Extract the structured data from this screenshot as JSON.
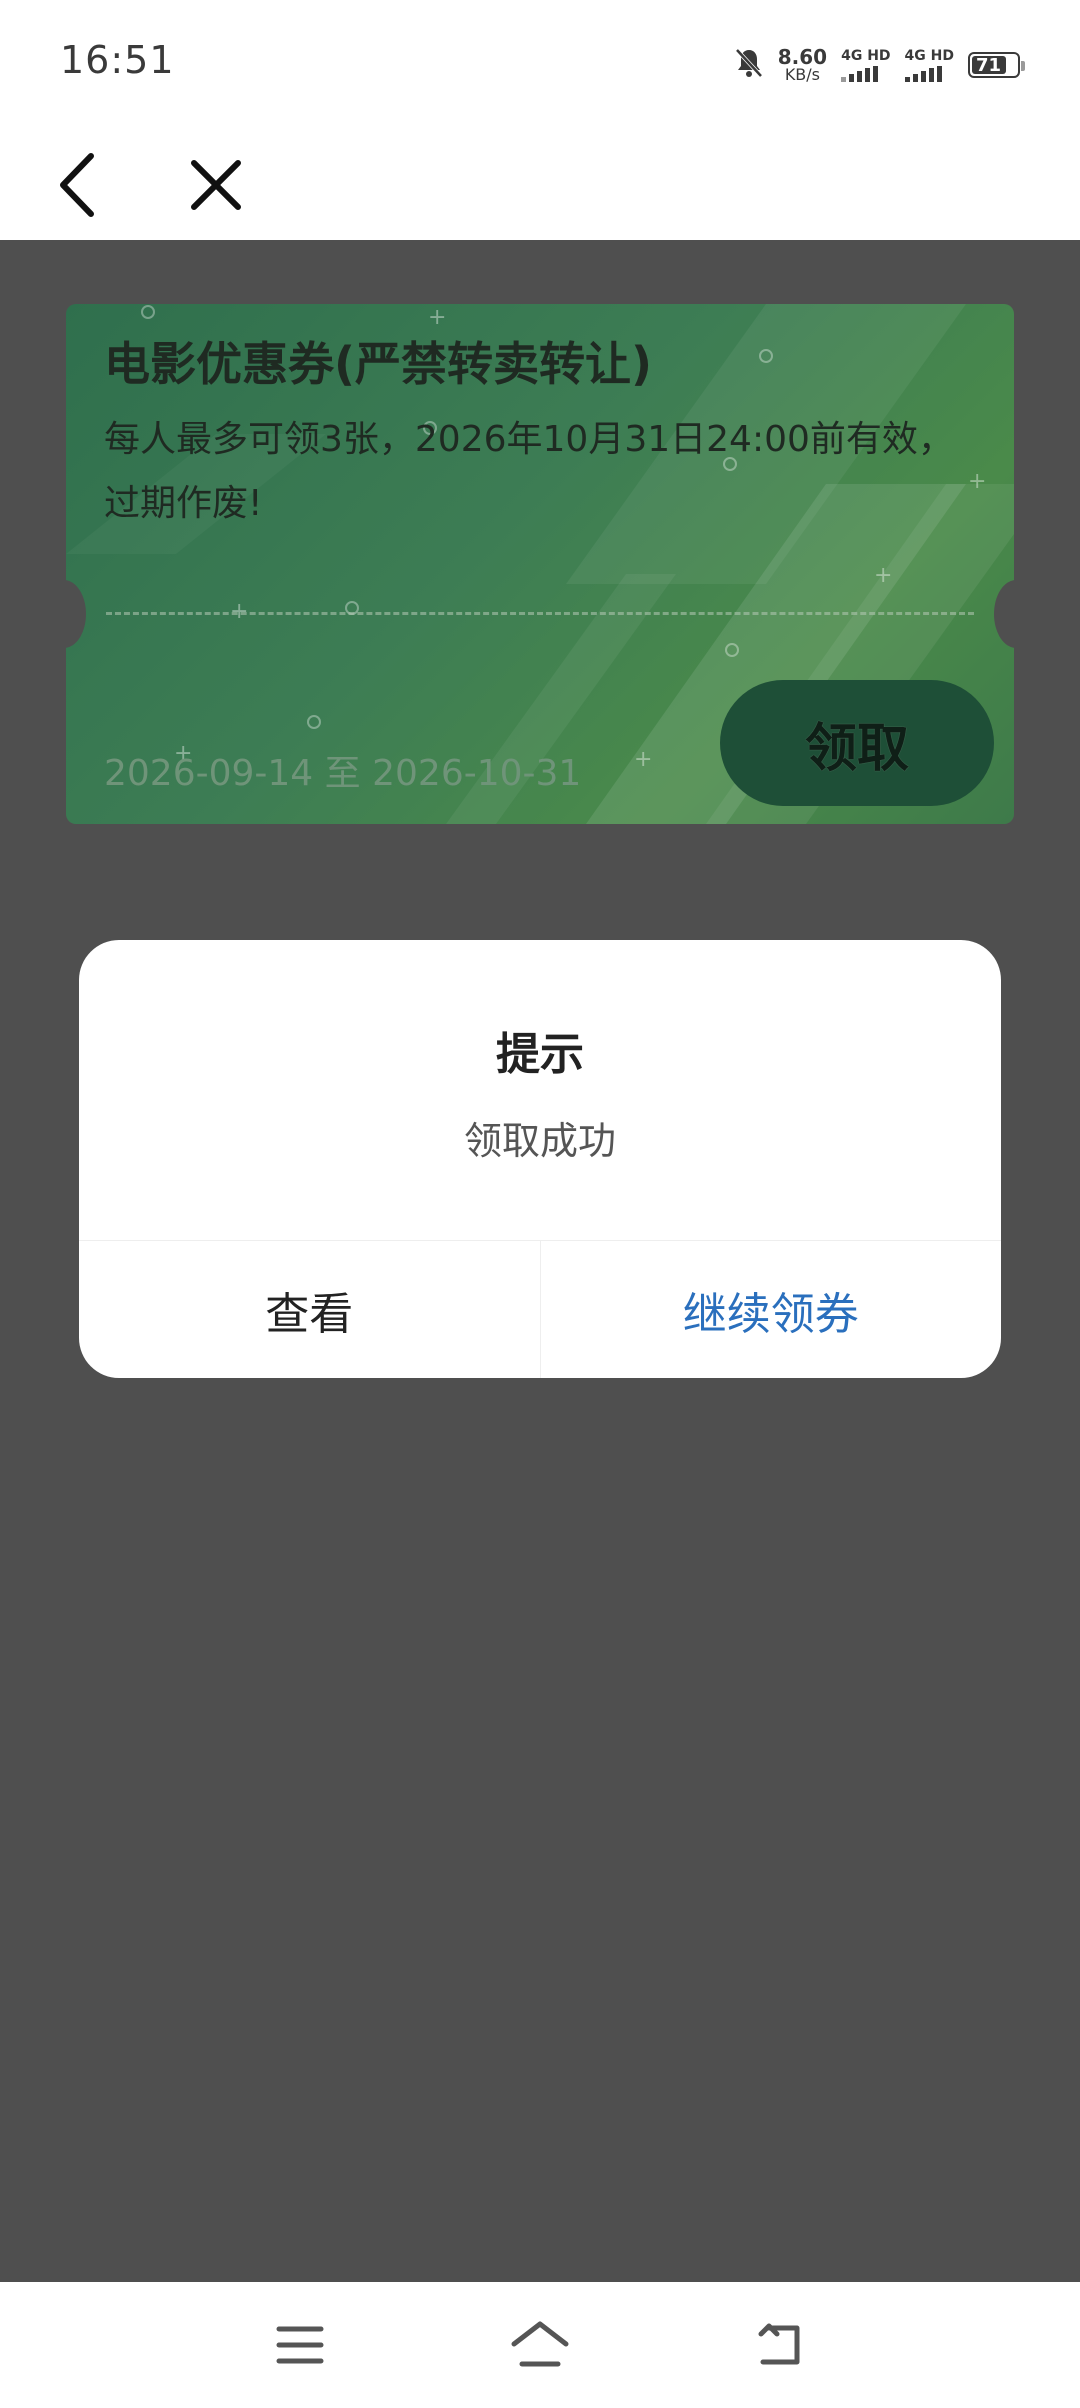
{
  "status_bar": {
    "time": "16:51",
    "net_speed_value": "8.60",
    "net_speed_unit": "KB/s",
    "sim1_label": "4G HD",
    "sim2_label": "4G HD",
    "battery_level": "71"
  },
  "coupon": {
    "title": "电影优惠券(严禁转卖转让)",
    "description": "每人最多可领3张，2026年10月31日24:00前有效，过期作废!",
    "validity": "2026-09-14 至 2026-10-31",
    "claim_label": "领取"
  },
  "dialog": {
    "title": "提示",
    "message": "领取成功",
    "view_label": "查看",
    "continue_label": "继续领券",
    "accent_color": "#2a6fbd"
  },
  "icons": {
    "back": "back-arrow-icon",
    "close": "close-icon",
    "mute": "bell-mute-icon",
    "menu": "menu-icon",
    "home": "home-icon",
    "return": "return-icon"
  }
}
